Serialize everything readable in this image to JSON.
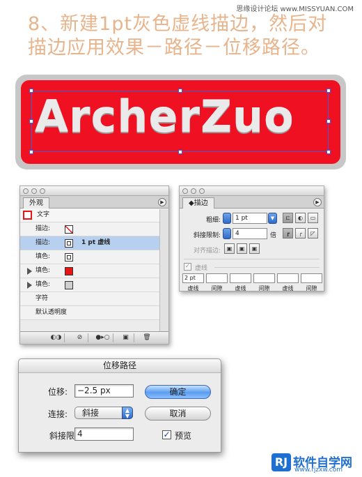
{
  "watermark_top": "思缘设计论坛  www.MISSYUAN.COM",
  "heading": {
    "line1": "8、新建1pt灰色虚线描边，然后对",
    "line2": "描边应用效果－路径－位移路径。"
  },
  "banner": {
    "text": "ArcherZuo",
    "color": "#ef1121"
  },
  "appearance_panel": {
    "tab": "外观",
    "menu_icon": "panel-menu-arrow",
    "object_label": "文字",
    "rows": [
      {
        "label": "描边:",
        "swatch": "none",
        "value": ""
      },
      {
        "label": "描边:",
        "swatch": "stroke",
        "value": "1 pt 虚线",
        "selected": true
      },
      {
        "label": "填色:",
        "swatch": "stroke",
        "value": ""
      },
      {
        "label": "填色:",
        "swatch": "red",
        "value": "",
        "arrow": true
      },
      {
        "label": "填色:",
        "swatch": "grey",
        "value": "",
        "arrow": true
      }
    ],
    "char_label": "字符",
    "opacity_label": "默认透明度",
    "bottom_icons": [
      "new-art-icon",
      "clear-icon",
      "reduce-icon",
      "duplicate-icon",
      "delete-icon"
    ]
  },
  "stroke_panel": {
    "tab": "描边",
    "weight_label": "粗细:",
    "weight_value": "1 pt",
    "miter_label": "斜接限制:",
    "miter_value": "4",
    "miter_unit": "倍",
    "align_label": "对齐描边:",
    "dashed_label": "虚线",
    "dash_values": [
      "2 pt",
      "",
      "",
      "",
      "",
      ""
    ],
    "dash_labels": [
      "虚线",
      "间隙",
      "虚线",
      "间隙",
      "虚线",
      "间隙"
    ]
  },
  "offset_dialog": {
    "title": "位移路径",
    "offset_label": "位移:",
    "offset_value": "−2.5 px",
    "join_label": "连接:",
    "join_value": "斜接",
    "miter_label": "斜接限制:",
    "miter_value": "4",
    "ok_label": "确定",
    "cancel_label": "取消",
    "preview_label": "预览",
    "preview_checked": true
  },
  "site_logo": {
    "badge": "RJ",
    "name": "软件自学网",
    "url": "www.rjzxw.com"
  }
}
